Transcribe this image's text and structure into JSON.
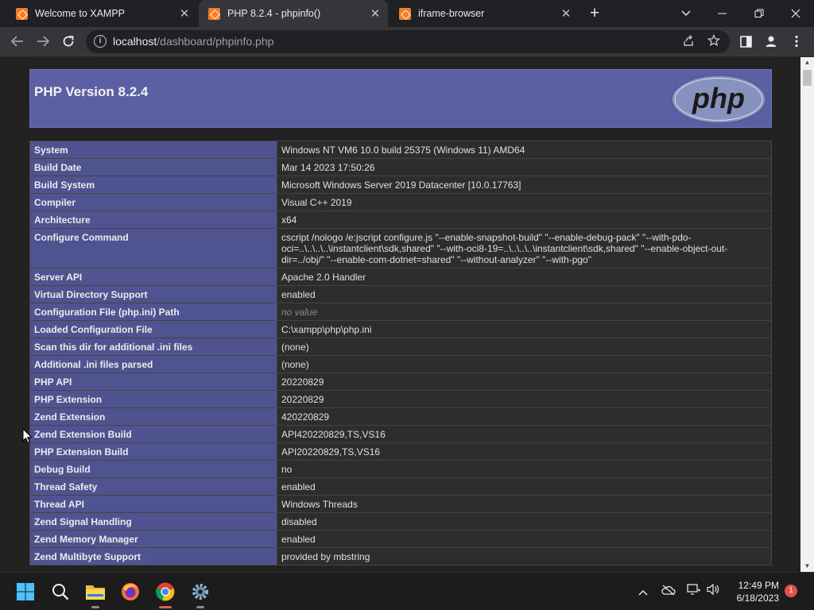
{
  "browser": {
    "tabs": [
      {
        "title": "Welcome to XAMPP",
        "active": false
      },
      {
        "title": "PHP 8.2.4 - phpinfo()",
        "active": true
      },
      {
        "title": "iframe-browser",
        "active": false
      }
    ],
    "url_host": "localhost",
    "url_path": "/dashboard/phpinfo.php"
  },
  "page": {
    "heading": "PHP Version 8.2.4",
    "logo_text": "php",
    "rows": [
      {
        "label": "System",
        "value": "Windows NT VM6 10.0 build 25375 (Windows 11) AMD64"
      },
      {
        "label": "Build Date",
        "value": "Mar 14 2023 17:50:26"
      },
      {
        "label": "Build System",
        "value": "Microsoft Windows Server 2019 Datacenter [10.0.17763]"
      },
      {
        "label": "Compiler",
        "value": "Visual C++ 2019"
      },
      {
        "label": "Architecture",
        "value": "x64"
      },
      {
        "label": "Configure Command",
        "value": "cscript /nologo /e:jscript configure.js \"--enable-snapshot-build\" \"--enable-debug-pack\" \"--with-pdo-oci=..\\..\\..\\..\\instantclient\\sdk,shared\" \"--with-oci8-19=..\\..\\..\\..\\instantclient\\sdk,shared\" \"--enable-object-out-dir=../obj/\" \"--enable-com-dotnet=shared\" \"--without-analyzer\" \"--with-pgo\""
      },
      {
        "label": "Server API",
        "value": "Apache 2.0 Handler"
      },
      {
        "label": "Virtual Directory Support",
        "value": "enabled"
      },
      {
        "label": "Configuration File (php.ini) Path",
        "value": "no value",
        "novalue": true
      },
      {
        "label": "Loaded Configuration File",
        "value": "C:\\xampp\\php\\php.ini"
      },
      {
        "label": "Scan this dir for additional .ini files",
        "value": "(none)"
      },
      {
        "label": "Additional .ini files parsed",
        "value": "(none)"
      },
      {
        "label": "PHP API",
        "value": "20220829"
      },
      {
        "label": "PHP Extension",
        "value": "20220829"
      },
      {
        "label": "Zend Extension",
        "value": "420220829"
      },
      {
        "label": "Zend Extension Build",
        "value": "API420220829,TS,VS16"
      },
      {
        "label": "PHP Extension Build",
        "value": "API20220829,TS,VS16"
      },
      {
        "label": "Debug Build",
        "value": "no"
      },
      {
        "label": "Thread Safety",
        "value": "enabled"
      },
      {
        "label": "Thread API",
        "value": "Windows Threads"
      },
      {
        "label": "Zend Signal Handling",
        "value": "disabled"
      },
      {
        "label": "Zend Memory Manager",
        "value": "enabled"
      },
      {
        "label": "Zend Multibyte Support",
        "value": "provided by mbstring"
      }
    ]
  },
  "taskbar": {
    "time": "12:49 PM",
    "date": "6/18/2023",
    "notification_count": "1"
  },
  "colors": {
    "header_bg": "#5b5fa3",
    "label_bg": "#4f5390",
    "value_bg": "#2d2d2d"
  }
}
